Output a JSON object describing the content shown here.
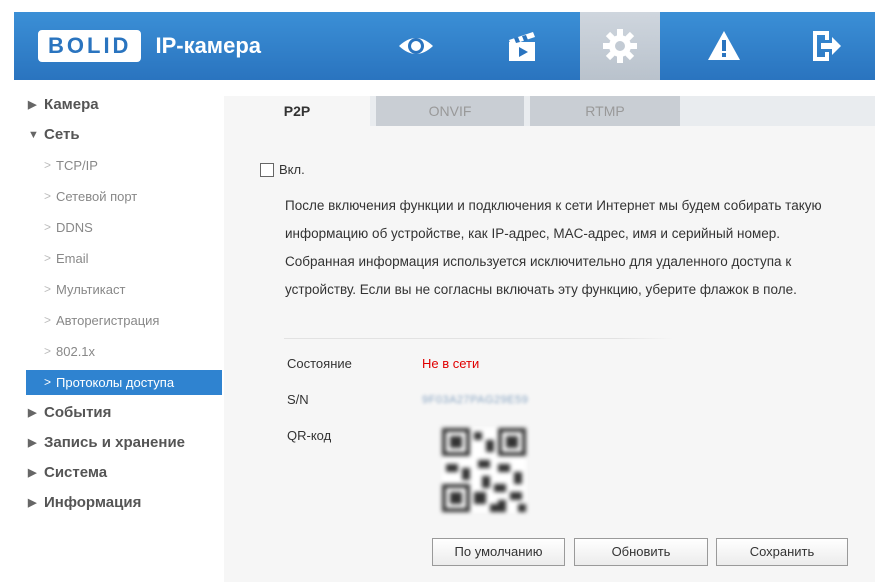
{
  "header": {
    "logo_brand": "BOLID",
    "logo_text": "IP-камера",
    "nav": [
      {
        "icon": "eye-icon"
      },
      {
        "icon": "clapperboard-icon"
      },
      {
        "icon": "gear-icon",
        "active": true
      },
      {
        "icon": "warning-icon"
      },
      {
        "icon": "logout-icon"
      }
    ],
    "colors": {
      "header_bg": "#2f80c9",
      "active_bg": "#c3cbd4",
      "accent": "#2f83d0"
    }
  },
  "sidebar": {
    "groups": [
      {
        "label": "Камера",
        "expanded": false
      },
      {
        "label": "Сеть",
        "expanded": true,
        "items": [
          "TCP/IP",
          "Сетевой порт",
          "DDNS",
          "Email",
          "Мультикаст",
          "Авторегистрация",
          "802.1x",
          "Протоколы доступа"
        ],
        "active_item": "Протоколы доступа"
      },
      {
        "label": "События",
        "expanded": false
      },
      {
        "label": "Запись и хранение",
        "expanded": false
      },
      {
        "label": "Система",
        "expanded": false
      },
      {
        "label": "Информация",
        "expanded": false
      }
    ]
  },
  "tabs": [
    {
      "label": "P2P",
      "active": true
    },
    {
      "label": "ONVIF",
      "active": false
    },
    {
      "label": "RTMP",
      "active": false
    }
  ],
  "p2p": {
    "enable_label": "Вкл.",
    "enable_checked": false,
    "description": "После включения функции и подключения к сети Интернет мы будем собирать такую информацию об устройстве, как IP-адрес, MAC-адрес, имя и серийный номер. Собранная информация используется исключительно для удаленного доступа к устройству. Если вы не согласны включать эту функцию, уберите флажок в поле.",
    "status_label": "Состояние",
    "status_value": "Не в сети",
    "status_color": "#e00000",
    "sn_label": "S/N",
    "sn_value": "9F03A27PAG29E59",
    "qr_label": "QR-код"
  },
  "buttons": {
    "default": "По умолчанию",
    "refresh": "Обновить",
    "save": "Сохранить"
  }
}
